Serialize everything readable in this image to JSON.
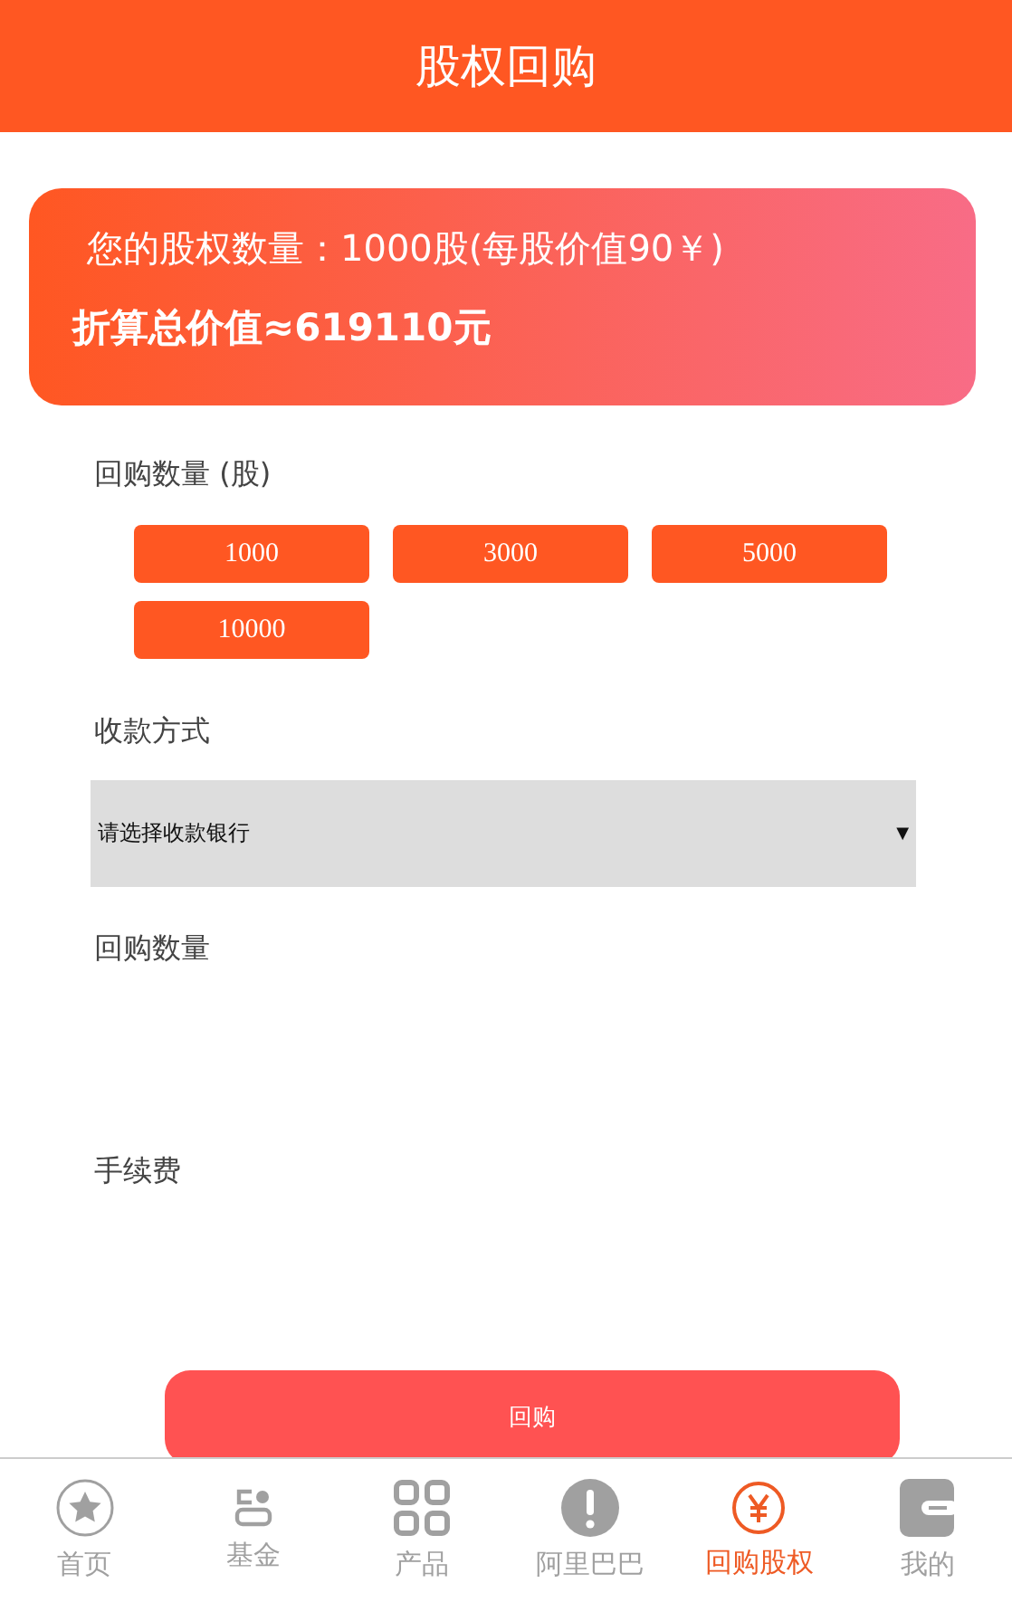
{
  "header": {
    "title": "股权回购"
  },
  "summary": {
    "holding": "您的股权数量：1000股(每股价值90￥)",
    "total": "折算总价值≈619110元"
  },
  "quantity": {
    "label": "回购数量 (股)",
    "options": [
      "1000",
      "3000",
      "5000",
      "10000"
    ]
  },
  "payment": {
    "label": "收款方式",
    "select": {
      "placeholder": "请选择收款银行",
      "arrow": "▼"
    }
  },
  "repurchase_amount": {
    "label": "回购数量"
  },
  "fee": {
    "label": "手续费"
  },
  "submit": {
    "label": "回购"
  },
  "tab_bar": [
    {
      "kind": "home",
      "label": "首页",
      "selected": false
    },
    {
      "kind": "fund",
      "label": "基金",
      "selected": false
    },
    {
      "kind": "products",
      "label": "产品",
      "selected": false
    },
    {
      "kind": "alibaba",
      "label": "阿里巴巴",
      "selected": false
    },
    {
      "kind": "repurchase",
      "label": "回购股权",
      "selected": true
    },
    {
      "kind": "mine",
      "label": "我的",
      "selected": false
    }
  ]
}
